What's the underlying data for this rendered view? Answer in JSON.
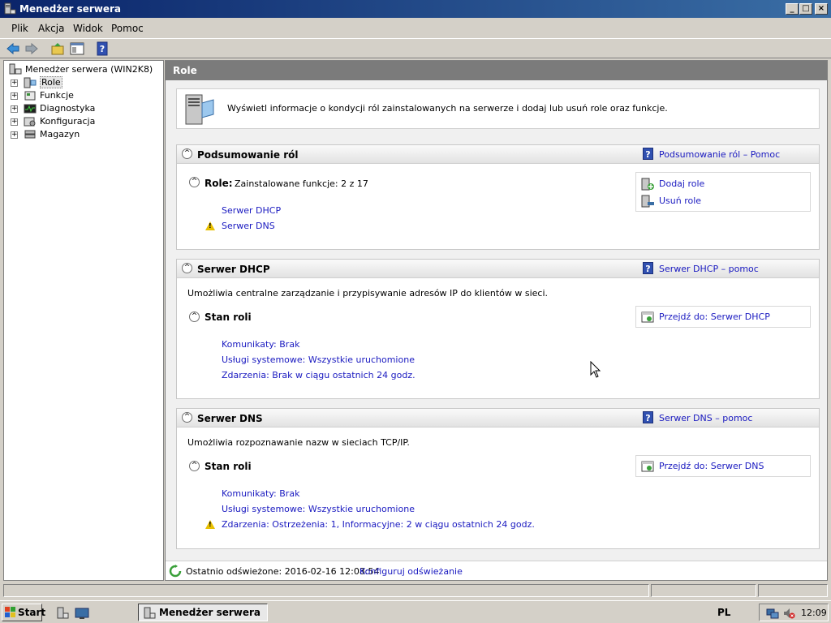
{
  "window": {
    "title": "Menedżer serwera"
  },
  "menu": [
    "Plik",
    "Akcja",
    "Widok",
    "Pomoc"
  ],
  "tree": {
    "root": "Menedżer serwera (WIN2K8)",
    "items": [
      {
        "label": "Role",
        "selected": true
      },
      {
        "label": "Funkcje"
      },
      {
        "label": "Diagnostyka"
      },
      {
        "label": "Konfiguracja"
      },
      {
        "label": "Magazyn"
      }
    ]
  },
  "right": {
    "header": "Role",
    "intro": "Wyświetl informacje o kondycji ról zainstalowanych na serwerze i dodaj lub usuń role oraz funkcje.",
    "summary": {
      "title": "Podsumowanie ról",
      "help": "Podsumowanie ról – Pomoc",
      "roles_label": "Role:",
      "roles_value": "Zainstalowane funkcje: 2 z 17",
      "roles": [
        {
          "name": "Serwer DHCP",
          "warning": false
        },
        {
          "name": "Serwer DNS",
          "warning": true
        }
      ],
      "actions": [
        "Dodaj role",
        "Usuń role"
      ]
    },
    "dhcp": {
      "title": "Serwer DHCP",
      "help": "Serwer DHCP – pomoc",
      "desc": "Umożliwia centralne zarządzanie i przypisywanie adresów IP do klientów w sieci.",
      "status_title": "Stan roli",
      "goto": "Przejdź do: Serwer DHCP",
      "lines": [
        "Komunikaty: Brak",
        "Usługi systemowe: Wszystkie uruchomione",
        "Zdarzenia: Brak w ciągu ostatnich 24 godz."
      ]
    },
    "dns": {
      "title": "Serwer DNS",
      "help": "Serwer DNS – pomoc",
      "desc": "Umożliwia rozpoznawanie nazw w sieciach TCP/IP.",
      "status_title": "Stan roli",
      "goto": "Przejdź do: Serwer DNS",
      "lines": [
        "Komunikaty: Brak",
        "Usługi systemowe: Wszystkie uruchomione",
        "Zdarzenia: Ostrzeżenia: 1, Informacyjne: 2 w ciągu ostatnich 24 godz."
      ],
      "warning_on_last": true
    },
    "refresh": {
      "text": "Ostatnio odświeżone: 2016-02-16 12:08:54",
      "link": "Konfiguruj odświeżanie"
    }
  },
  "taskbar": {
    "start": "Start",
    "task": "Menedżer serwera",
    "lang": "PL",
    "clock": "12:09"
  },
  "colors": {
    "link": "#1a1ac0",
    "title_bar": "#0a246a",
    "header": "#7b7b7b",
    "warning": "#e8c000"
  }
}
